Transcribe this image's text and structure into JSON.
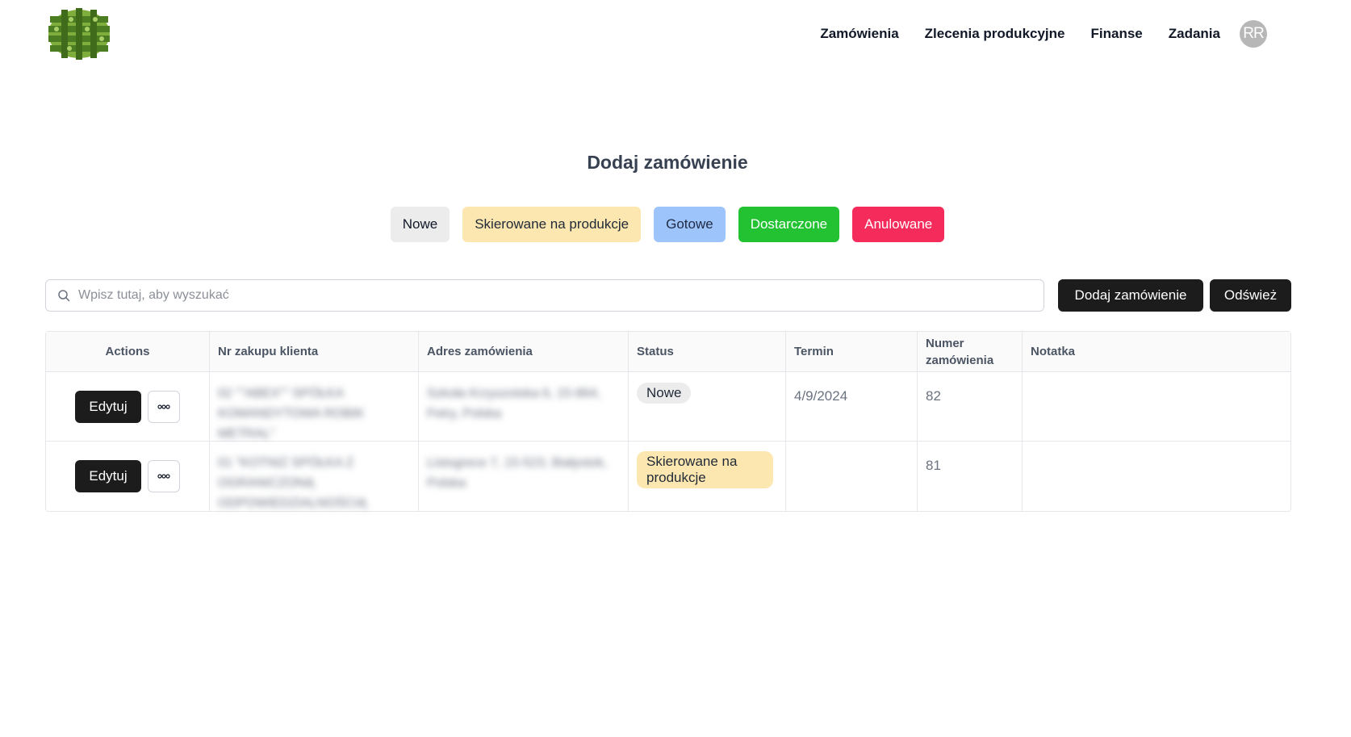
{
  "nav": {
    "items": [
      "Zamówienia",
      "Zlecenia produkcyjne",
      "Finanse",
      "Zadania"
    ],
    "avatar_initials": "RR"
  },
  "page": {
    "title": "Dodaj zamówienie"
  },
  "filters": [
    "Nowe",
    "Skierowane na produkcje",
    "Gotowe",
    "Dostarczone",
    "Anulowane"
  ],
  "colors": {
    "nowe": "#ececec",
    "skierowane": "#fde7b0",
    "gotowe": "#9ec5fb",
    "dostarczone": "#22c232",
    "anulowane": "#f52c5b",
    "primary_button": "#1c1c1c"
  },
  "search": {
    "placeholder": "Wpisz tutaj, aby wyszukać",
    "value": ""
  },
  "toolbar": {
    "add_label": "Dodaj zamówienie",
    "refresh_label": "Odśwież"
  },
  "table": {
    "columns": [
      "Actions",
      "Nr zakupu klienta",
      "Adres zamówienia",
      "Status",
      "Termin",
      "Numer zamówienia",
      "Notatka"
    ],
    "edit_label": "Edytuj",
    "rows": [
      {
        "client": "02 \"\"ABEX\"\" SPÓŁKA KOMANDYTOWA ROBIK METRAL\"",
        "address": "Szkoła Krzyszotska 6, 15-864, Fetry, Polska",
        "status": "Nowe",
        "termin": "4/9/2024",
        "number": "82",
        "note": ""
      },
      {
        "client": "01 \"KOTNIZ SPÓŁKA Z OGRANICZONĄ ODPOWIEDZIALNOŚCIĄ",
        "address": "Listogrece 7, 15-523, Białystok, Polska",
        "status": "Skierowane na produkcje",
        "termin": "",
        "number": "81",
        "note": ""
      }
    ]
  }
}
